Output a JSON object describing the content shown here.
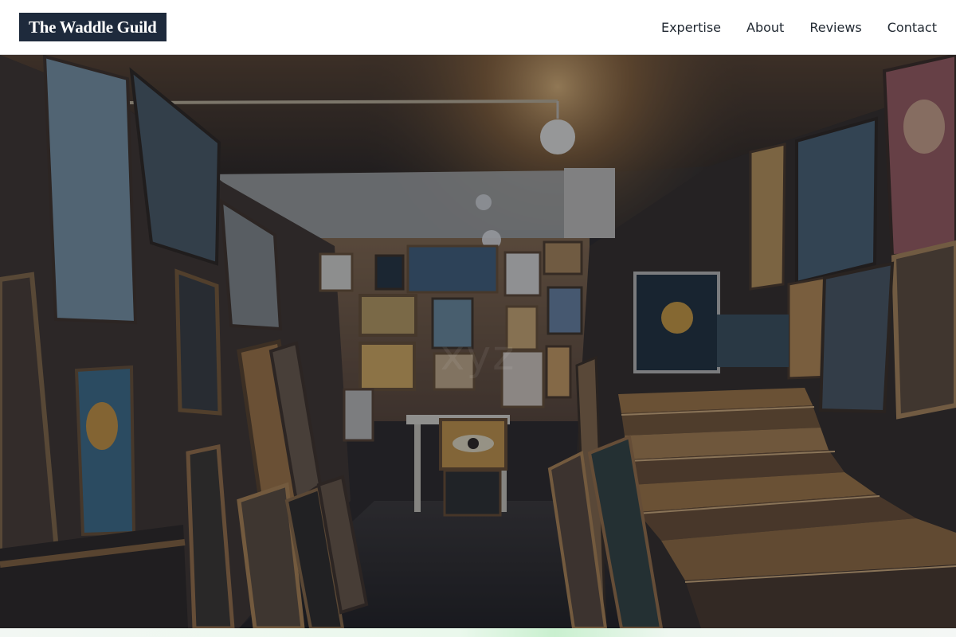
{
  "header": {
    "logo_text": "The Waddle Guild",
    "nav": [
      {
        "label": "Expertise"
      },
      {
        "label": "About"
      },
      {
        "label": "Reviews"
      },
      {
        "label": "Contact"
      }
    ]
  },
  "hero": {
    "image_subject": "dim art gallery storeroom filled with stacked framed paintings",
    "watermark_text": "xyz"
  },
  "colors": {
    "logo_background": "#1e2a3c",
    "nav_text": "#222a33",
    "hero_overlay": "#141a28"
  }
}
